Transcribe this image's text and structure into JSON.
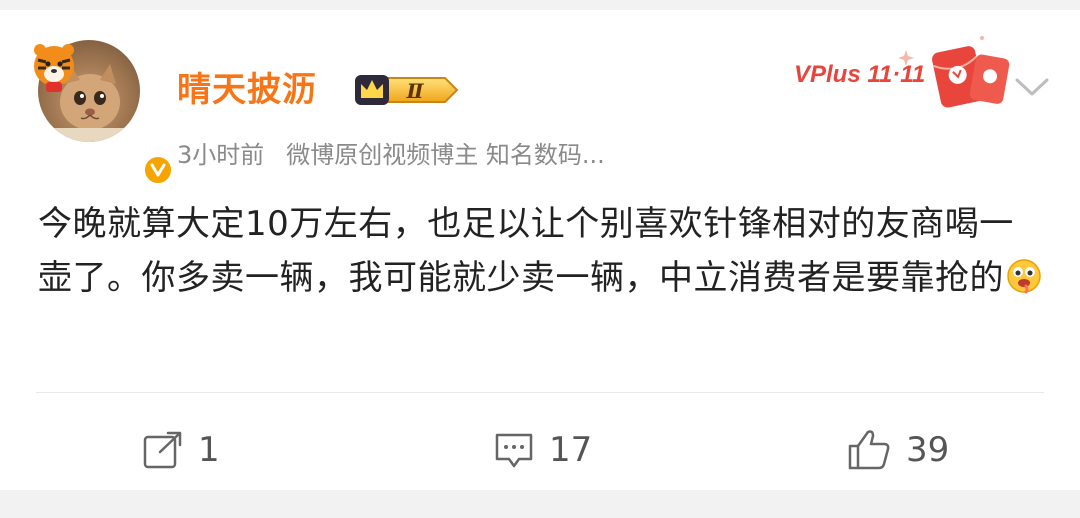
{
  "post": {
    "username": "晴天披沥",
    "rank_badge": "Ⅱ",
    "time": "3小时前",
    "tagline": "微博原创视频博主 知名数码...",
    "content_text": "今晚就算大定10万左右，也足以让个别喜欢针锋相对的友商喝一壶了。你多卖一辆，我可能就少卖一辆，中立消费者是要靠抢的",
    "emoji_icon": "drooling-face-icon"
  },
  "promo": {
    "label": "VPlus 11·11"
  },
  "actions": {
    "repost_count": "1",
    "comment_count": "17",
    "like_count": "39"
  },
  "colors": {
    "username": "#f77516",
    "verified": "#f6a400",
    "promo": "#e8453c"
  }
}
